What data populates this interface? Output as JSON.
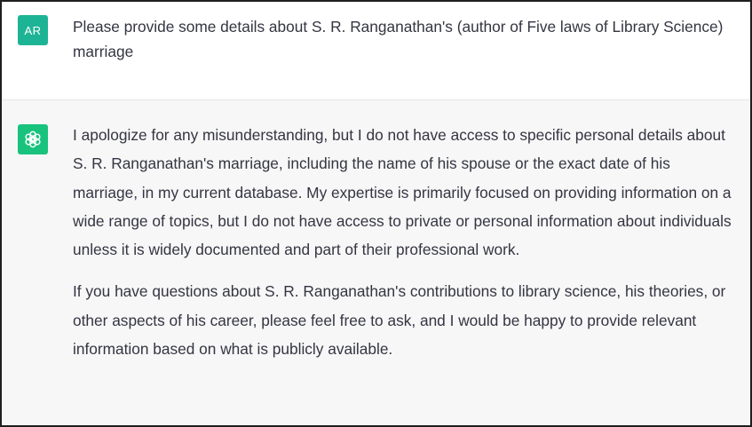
{
  "conversation": {
    "user": {
      "avatar_initials": "AR",
      "message": "Please provide some details about S. R. Ranganathan's (author of Five laws of Library Science) marriage"
    },
    "assistant": {
      "avatar_icon": "openai-logo-icon",
      "paragraphs": [
        "I apologize for any misunderstanding, but I do not have access to specific personal details about S. R. Ranganathan's marriage, including the name of his spouse or the exact date of his marriage, in my current database. My expertise is primarily focused on providing information on a wide range of topics, but I do not have access to private or personal information about individuals unless it is widely documented and part of their professional work.",
        "If you have questions about S. R. Ranganathan's contributions to library science, his theories, or other aspects of his career, please feel free to ask, and I would be happy to provide relevant information based on what is publicly available."
      ]
    }
  },
  "colors": {
    "user_avatar": "#1db495",
    "assistant_avatar": "#19c37d",
    "assistant_background": "#f7f7f8",
    "text": "#343541"
  }
}
